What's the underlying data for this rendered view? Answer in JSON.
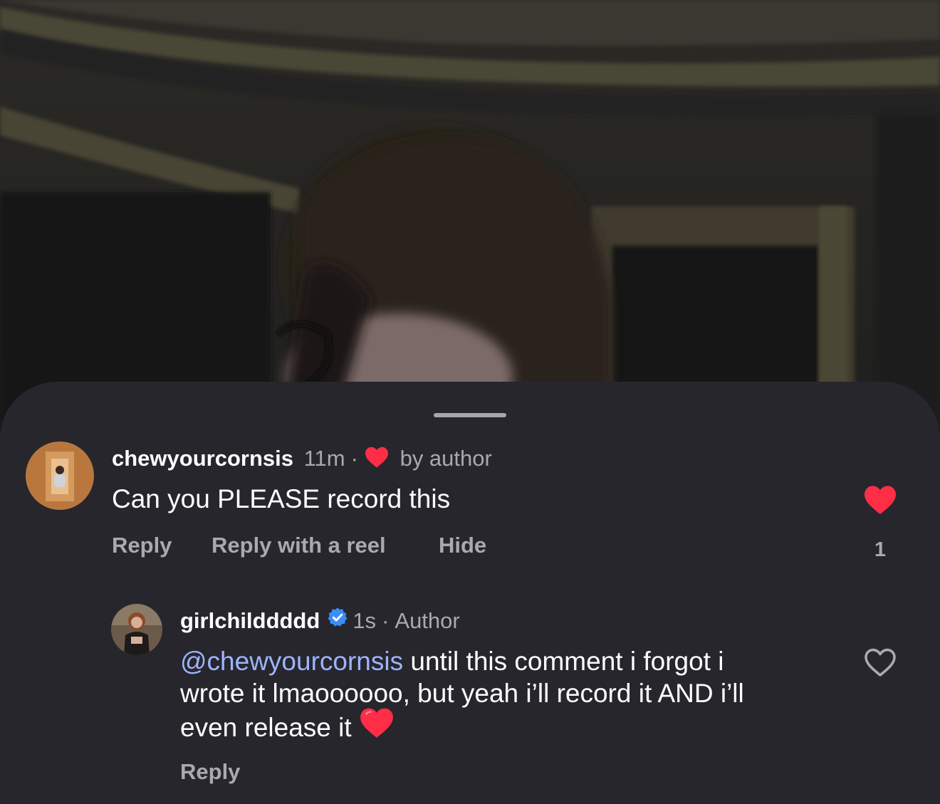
{
  "comments": [
    {
      "username": "chewyourcornsis",
      "time": "11m",
      "liked_by_author_label": "by author",
      "text": "Can you PLEASE record this",
      "actions": [
        "Reply",
        "Reply with a reel",
        "Hide"
      ],
      "like_count": "1",
      "liked": true
    }
  ],
  "replies": [
    {
      "username": "girlchilddddd",
      "verified": true,
      "time": "1s",
      "badge": "Author",
      "mention": "@chewyourcornsis",
      "text_line1": " until this comment i forgot i",
      "text_line2": "wrote it lmaoooooo, but yeah i’ll record it AND i’ll",
      "text_line3": "even release it ",
      "emoji": "❤️",
      "reply_label": "Reply",
      "liked": false
    }
  ],
  "colors": {
    "heart_red": "#ff2d46",
    "mention_blue": "#9fb3ff",
    "verified_blue": "#3b8df5"
  }
}
